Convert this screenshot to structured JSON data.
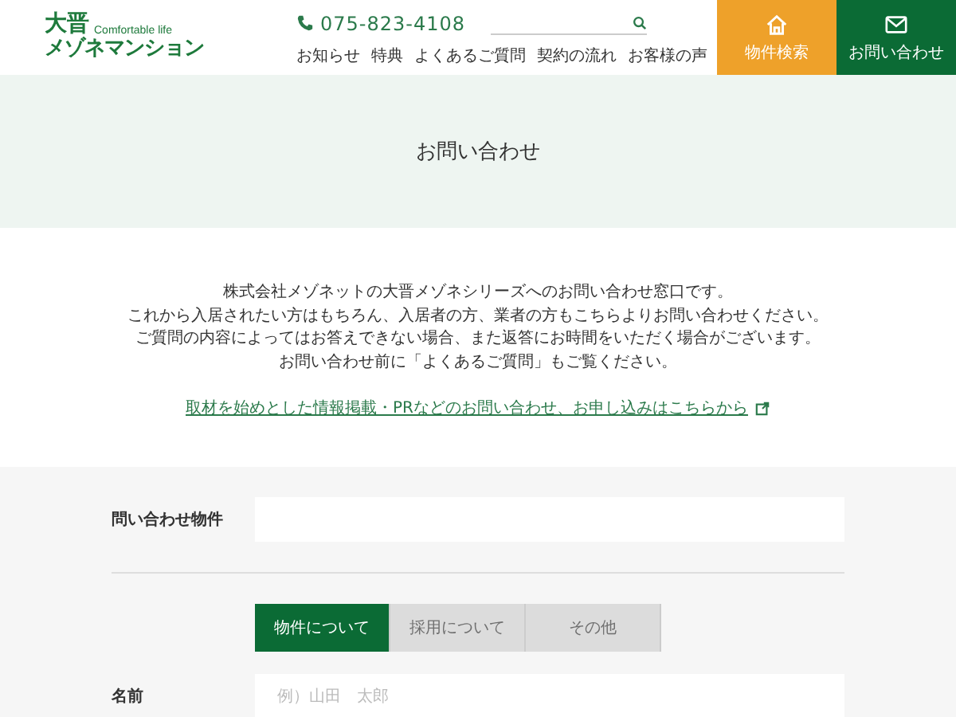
{
  "header": {
    "logo_main": "大晋",
    "logo_tagline": "Comfortable life",
    "logo_sub": "メゾネマンション",
    "phone": "075-823-4108",
    "nav": [
      "お知らせ",
      "特典",
      "よくあるご質問",
      "契約の流れ",
      "お客様の声"
    ],
    "actions": [
      {
        "label": "物件検索",
        "kind": "home"
      },
      {
        "label": "お問い合わせ",
        "kind": "mail"
      }
    ]
  },
  "hero": {
    "title": "お問い合わせ"
  },
  "intro": {
    "lines": [
      "株式会社メゾネットの大晋メゾネシリーズへのお問い合わせ窓口です。",
      "これから入居されたい方はもちろん、入居者の方、業者の方もこちらよりお問い合わせください。",
      "ご質問の内容によってはお答えできない場合、また返答にお時間をいただく場合がございます。",
      "お問い合わせ前に「よくあるご質問」もご覧ください。"
    ],
    "link": "取材を始めとした情報掲載・PRなどのお問い合わせ、お申し込みはこちらから"
  },
  "form": {
    "property_label": "問い合わせ物件",
    "tabs": [
      {
        "label": "物件について",
        "selected": true
      },
      {
        "label": "採用について",
        "selected": false
      },
      {
        "label": "その他",
        "selected": false
      }
    ],
    "name_label": "名前",
    "name_placeholder": "例）山田　太郎"
  }
}
